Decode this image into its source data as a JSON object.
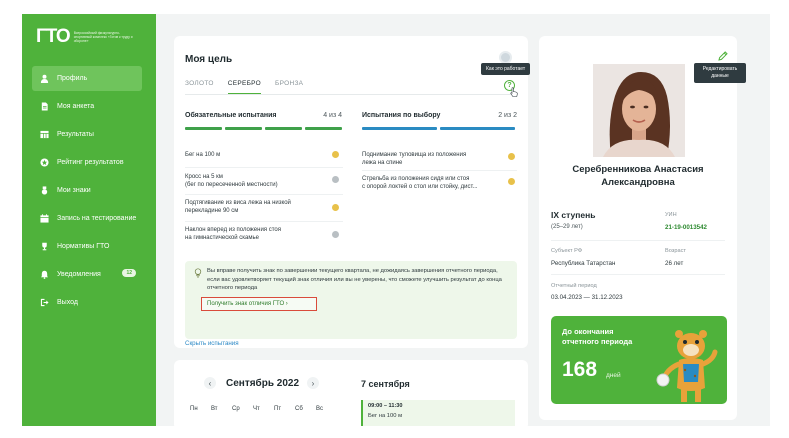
{
  "logo": {
    "mark": "ГТО",
    "text": "Всероссийский физкультурно-спортивный комплекс «Готов к труду и обороне»"
  },
  "nav": {
    "items": [
      {
        "label": "Профиль",
        "icon": "user-icon"
      },
      {
        "label": "Моя анкета",
        "icon": "document-icon"
      },
      {
        "label": "Результаты",
        "icon": "table-icon"
      },
      {
        "label": "Рейтинг результатов",
        "icon": "rating-icon"
      },
      {
        "label": "Мои знаки",
        "icon": "medal-icon"
      },
      {
        "label": "Запись на тестирование",
        "icon": "calendar-icon"
      },
      {
        "label": "Нормативы ГТО",
        "icon": "trophy-icon"
      },
      {
        "label": "Уведомления",
        "icon": "bell-icon",
        "badge": "12"
      },
      {
        "label": "Выход",
        "icon": "logout-icon"
      }
    ]
  },
  "goal": {
    "title": "Моя цель",
    "tabs": [
      "ЗОЛОТО",
      "СЕРЕБРО",
      "БРОНЗА"
    ],
    "active_tab": "СЕРЕБРО",
    "help_glyph": "?",
    "tooltip": "Как это работает",
    "mandatory": {
      "title": "Обязательные испытания",
      "count": "4 из 4",
      "items": [
        {
          "name": "Бег на 100 м",
          "status_color": "#e8c14a"
        },
        {
          "name": "Кросс на 5 км\n(бег по пересеченной местности)",
          "status_color": "#b9bfc3"
        },
        {
          "name": "Подтягивание из виса лежа на низкой\nперекладине 90 см",
          "status_color": "#e8c14a"
        },
        {
          "name": "Наклон вперед из положения стоя\nна гимнастической скамье",
          "status_color": "#b9bfc3"
        }
      ]
    },
    "optional": {
      "title": "Испытания по выбору",
      "count": "2 из 2",
      "items": [
        {
          "name": "Поднимание туловища из положения\nлежа на спине",
          "status_color": "#e8c14a"
        },
        {
          "name": "Стрельба из положения сидя или стоя\nс опорой локтей о стол или стойку, дист...",
          "status_color": "#e8c14a"
        }
      ]
    },
    "hint": {
      "text": "Вы вправе получить знак по завершении текущего квартала, не дожидаясь завершения отчетного периода, если вас удовлетворяет текущий знак отличия или вы не уверены, что сможете улучшить результат до конца отчетного периода",
      "button": "Получить знак отличия ГТО  ›"
    },
    "hide_link": "Скрыть испытания"
  },
  "calendar": {
    "prev": "‹",
    "next": "›",
    "month": "Сентябрь 2022",
    "weekdays": [
      "Пн",
      "Вт",
      "Ср",
      "Чт",
      "Пт",
      "Сб",
      "Вс"
    ],
    "selected_date": "7 сентября",
    "event": {
      "time": "09:00 – 11:30",
      "title": "Бег на 100 м"
    }
  },
  "profile": {
    "edit_tooltip": "Редактировать данные",
    "full_name": "Серебренникова Анастасия\nАлександровна",
    "level": "IX ступень",
    "age_range": "(25–29 лет)",
    "uin_label": "УИН",
    "uin": "21-19-0013542",
    "region_label": "Субъект РФ",
    "region": "Республика Татарстан",
    "age_label": "Возраст",
    "age": "26 лет",
    "period_label": "Отчетный период",
    "period": "03.04.2023 — 31.12.2023",
    "countdown_label": "До окончания\nотчетного периода",
    "countdown_value": "168",
    "countdown_unit": "дней"
  },
  "colors": {
    "brand_green": "#4fb23b",
    "gold": "#e8c14a",
    "bar_green": "#3fa14a",
    "bar_blue": "#2a8bc2"
  }
}
